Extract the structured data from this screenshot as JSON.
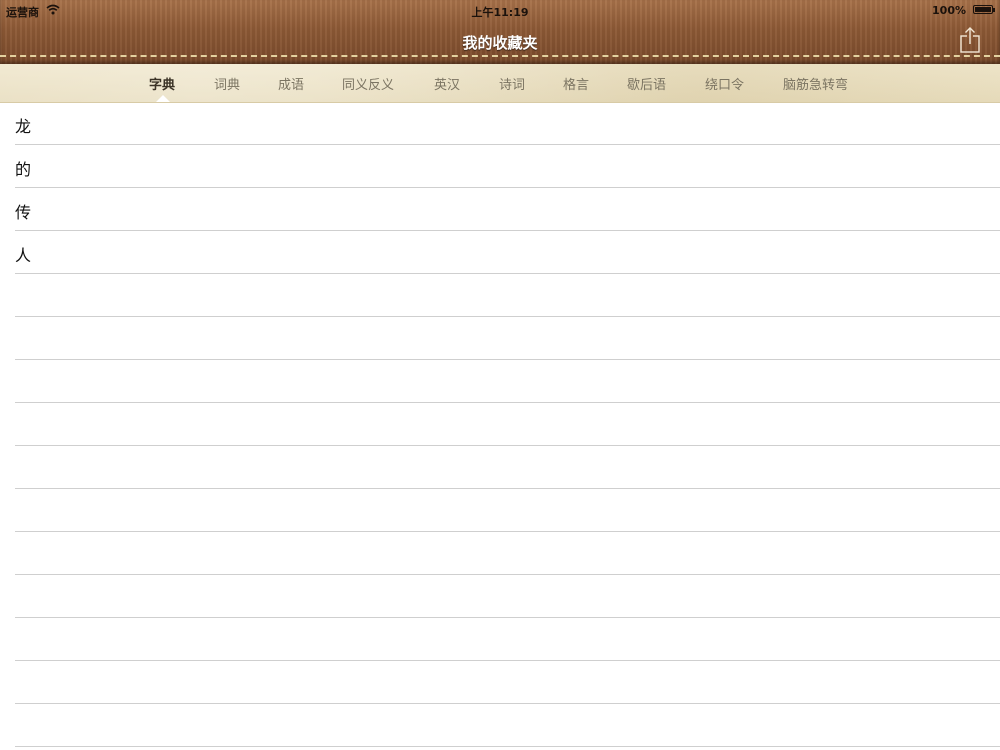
{
  "status_bar": {
    "carrier": "运营商",
    "time": "上午11:19",
    "battery": "100%"
  },
  "header": {
    "title": "我的收藏夹",
    "share_icon": "share-icon"
  },
  "tabs": [
    {
      "label": "字典",
      "active": true
    },
    {
      "label": "词典",
      "active": false
    },
    {
      "label": "成语",
      "active": false
    },
    {
      "label": "同义反义",
      "active": false
    },
    {
      "label": "英汉",
      "active": false
    },
    {
      "label": "诗词",
      "active": false
    },
    {
      "label": "格言",
      "active": false
    },
    {
      "label": "歇后语",
      "active": false
    },
    {
      "label": "绕口令",
      "active": false
    },
    {
      "label": "脑筋急转弯",
      "active": false
    }
  ],
  "favorites": [
    "龙",
    "的",
    "传",
    "人"
  ],
  "colors": {
    "leather": "#8e5a36",
    "stitch": "#e9d9a6",
    "parchment": "#e7dcbc",
    "active_tab": "#3b3327",
    "inactive_tab": "#7b7462",
    "divider": "#cfcfcf"
  }
}
